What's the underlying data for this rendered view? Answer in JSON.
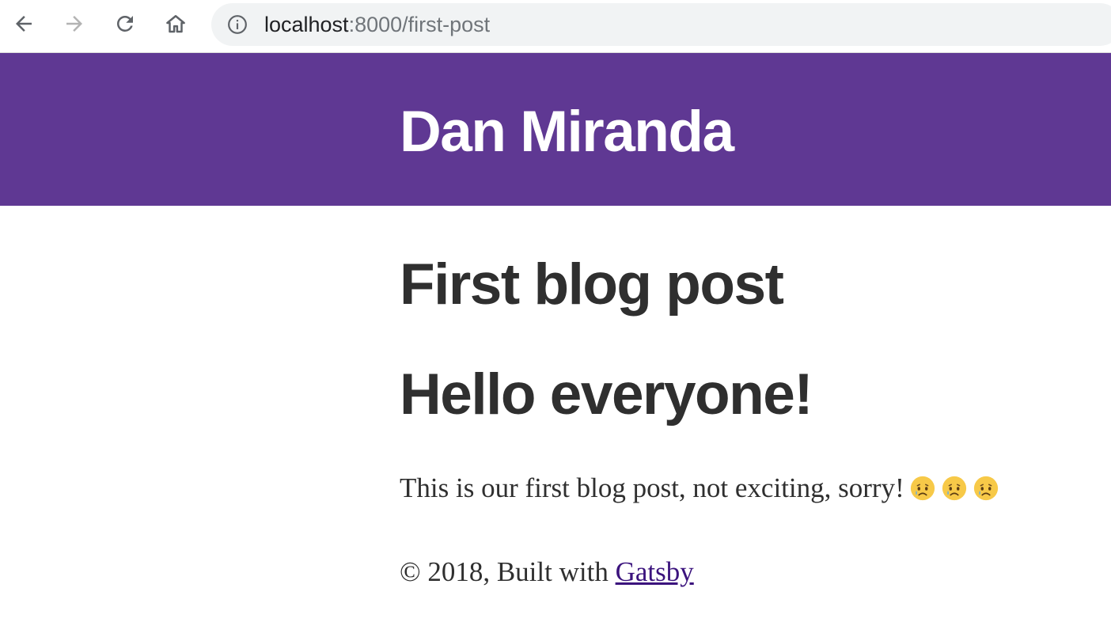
{
  "browser": {
    "back_icon": "arrow-left-icon",
    "forward_icon": "arrow-right-icon",
    "reload_icon": "reload-icon",
    "home_icon": "home-icon",
    "info_icon": "info-icon",
    "url_host": "localhost",
    "url_rest": ":8000/first-post"
  },
  "site": {
    "title": "Dan Miranda",
    "header_color": "#5f3893"
  },
  "post": {
    "title": "First blog post",
    "heading": "Hello everyone!",
    "body_text": "This is our first blog post, not exciting, sorry!",
    "emojis": [
      "crying-face-emoji",
      "crying-face-emoji",
      "crying-face-emoji"
    ]
  },
  "footer": {
    "text": "© 2018, Built with ",
    "link_label": "Gatsby"
  }
}
